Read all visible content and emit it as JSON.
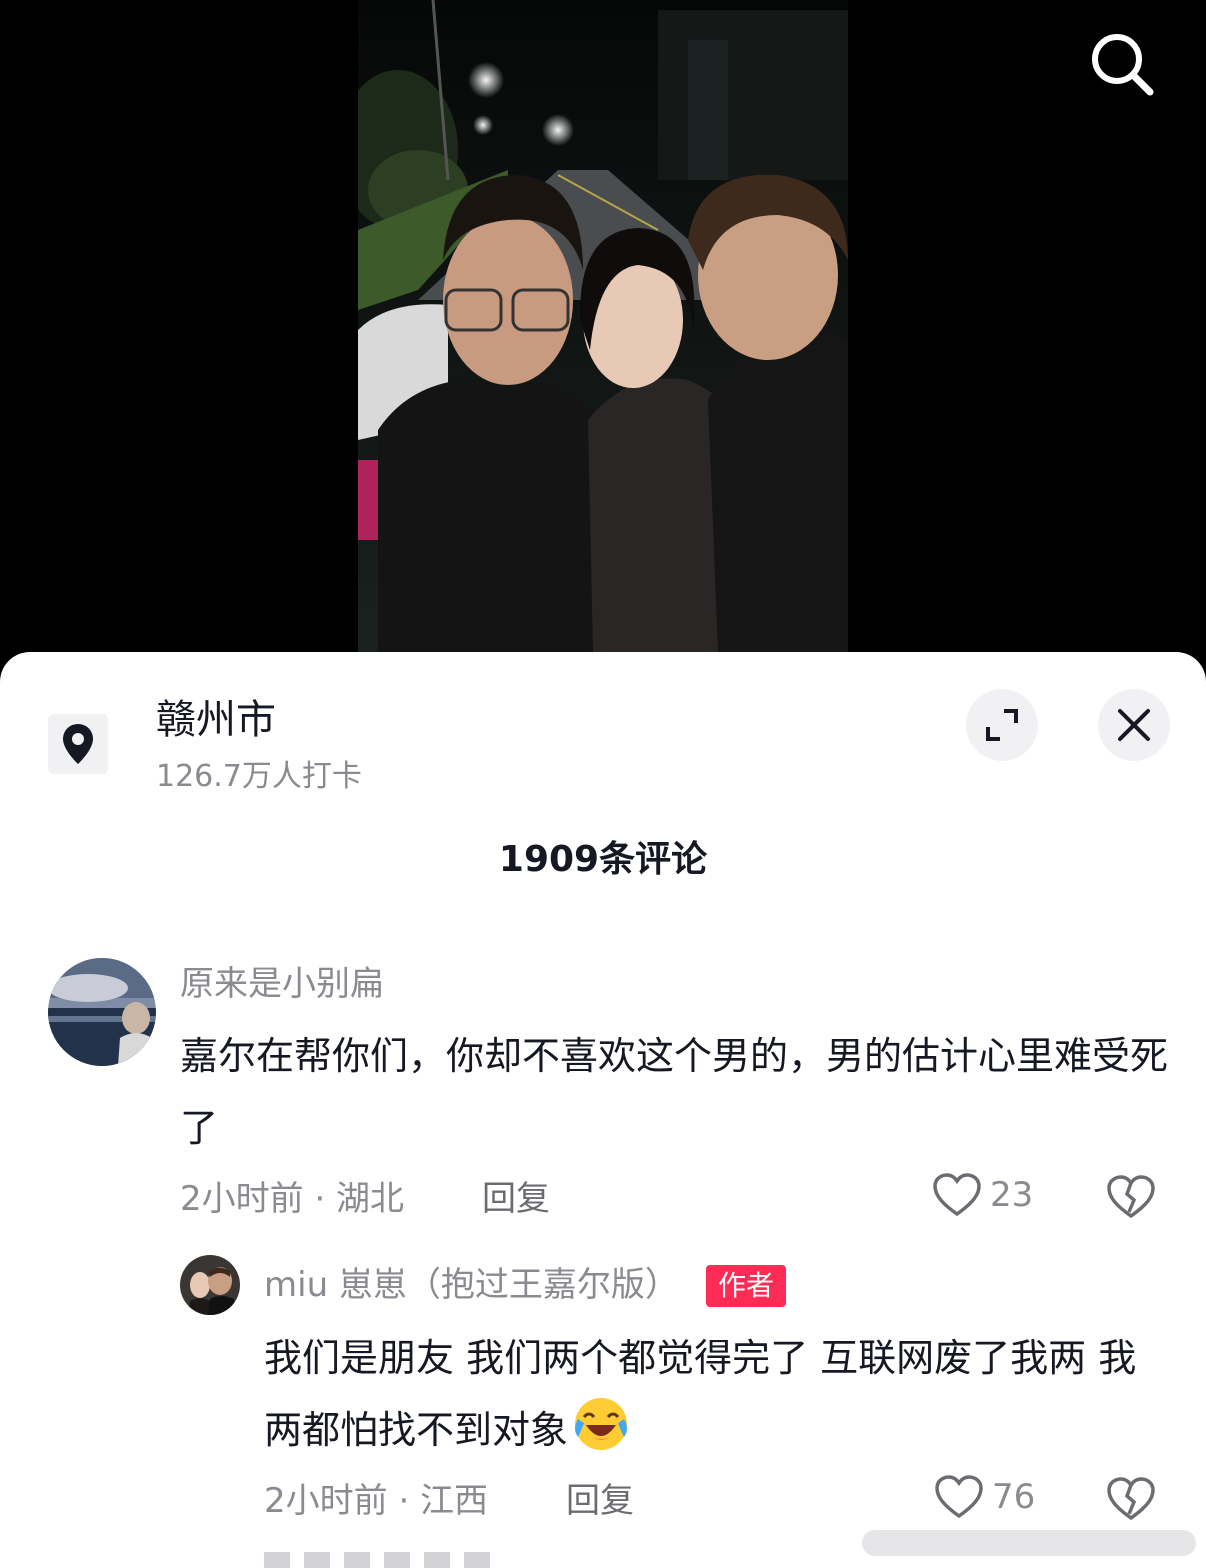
{
  "location": {
    "name": "赣州市",
    "checkins": "126.7万人打卡",
    "icon": "location-pin-icon"
  },
  "header": {
    "comment_count": "1909条评论"
  },
  "comments": [
    {
      "username": "原来是小别扁",
      "text": "嘉尔在帮你们，你却不喜欢这个男的，男的估计心里难受死了",
      "meta": "2小时前 · 湖北",
      "reply_label": "回复",
      "likes": "23"
    },
    {
      "username": "miu 崽崽（抱过王嘉尔版）",
      "badge": "作者",
      "text": "我们是朋友 我们两个都觉得完了 互联网废了我两 我两都怕找不到对象",
      "emoji": "laughing-crying-emoji",
      "meta": "2小时前 · 江西",
      "reply_label": "回复",
      "likes": "76"
    }
  ],
  "colors": {
    "accent": "#fe2c55",
    "text": "#161823",
    "muted": "#8a8b91"
  }
}
